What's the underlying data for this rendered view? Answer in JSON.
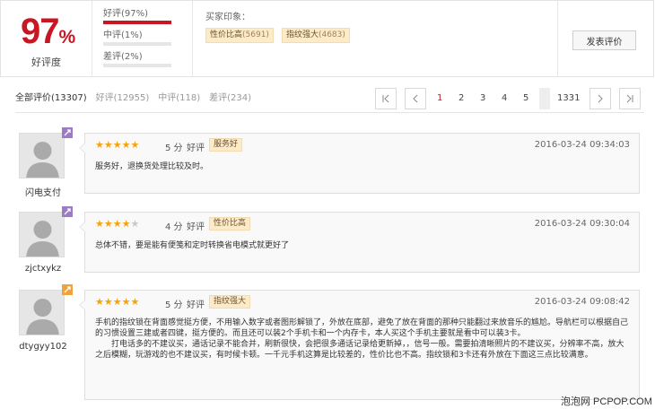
{
  "summary": {
    "rate_number": "97",
    "rate_percent": "%",
    "rate_label": "好评度",
    "bars": [
      {
        "label": "好评(97%)",
        "fill": 1.0
      },
      {
        "label": "中评(1%)",
        "fill": 0.0
      },
      {
        "label": "差评(2%)",
        "fill": 0.0
      }
    ],
    "impression_title": "买家印象：",
    "tags": [
      {
        "name": "性价比高",
        "count": "(5691)"
      },
      {
        "name": "指纹强大",
        "count": "(4683)"
      }
    ],
    "post_button": "发表评价"
  },
  "filters": [
    {
      "label": "全部评价(13307)",
      "active": true
    },
    {
      "label": "好评(12955)",
      "active": false
    },
    {
      "label": "中评(118)",
      "active": false
    },
    {
      "label": "差评(234)",
      "active": false
    }
  ],
  "pager": {
    "first": "|<",
    "prev": "<",
    "pages": [
      "1",
      "2",
      "3",
      "4",
      "5"
    ],
    "last_page": "1331",
    "next": ">",
    "last": ">|",
    "current": "1"
  },
  "reviews": [
    {
      "user": "闪电支付",
      "level_color": "purple",
      "stars": 5,
      "score": "5 分",
      "verdict": "好评",
      "tag": "服务好",
      "time": "2016-03-24 09:34:03",
      "content": [
        "服务好，退换货处理比较及时。"
      ]
    },
    {
      "user": "zjctxykz",
      "level_color": "purple",
      "stars": 4,
      "score": "4 分",
      "verdict": "好评",
      "tag": "性价比高",
      "time": "2016-03-24 09:30:04",
      "content": [
        "总体不错，要是能有便笺和定时转换省电模式就更好了"
      ]
    },
    {
      "user": "dtygyy102",
      "level_color": "orange",
      "stars": 5,
      "score": "5 分",
      "verdict": "好评",
      "tag": "指纹强大",
      "time": "2016-03-24 09:08:42",
      "content": [
        "手机的指纹锁在背面感觉挺方便，不用输入数字或者图形解锁了，外放在底部，避免了放在背面的那种只能翻过来放音乐的尴尬。导航栏可以根据自己的习惯设置三建或者四键，挺方便的。而且还可以装2个手机卡和一个内存卡，本人买这个手机主要就是看中可以装3卡。",
        "打电话多的不建议买，通话记录不能合并，刷新很快，会把很多通话记录给更新掉，，信号一般。需要拍清晰照片的不建议买，分辨率不高，放大之后模糊，玩游戏的也不建议买，有时候卡顿。一千元手机这算是比较差的，性价比也不高。指纹锁和3卡还有外放在下面这三点比较满意。"
      ]
    }
  ],
  "watermark": "泡泡网 PCPOP.COM",
  "colors": {
    "accent": "#c81623",
    "star": "#f5a30b",
    "tag_bg": "#fdebc8",
    "level_purple": "#9c7ac6",
    "level_orange": "#f0a23c"
  }
}
